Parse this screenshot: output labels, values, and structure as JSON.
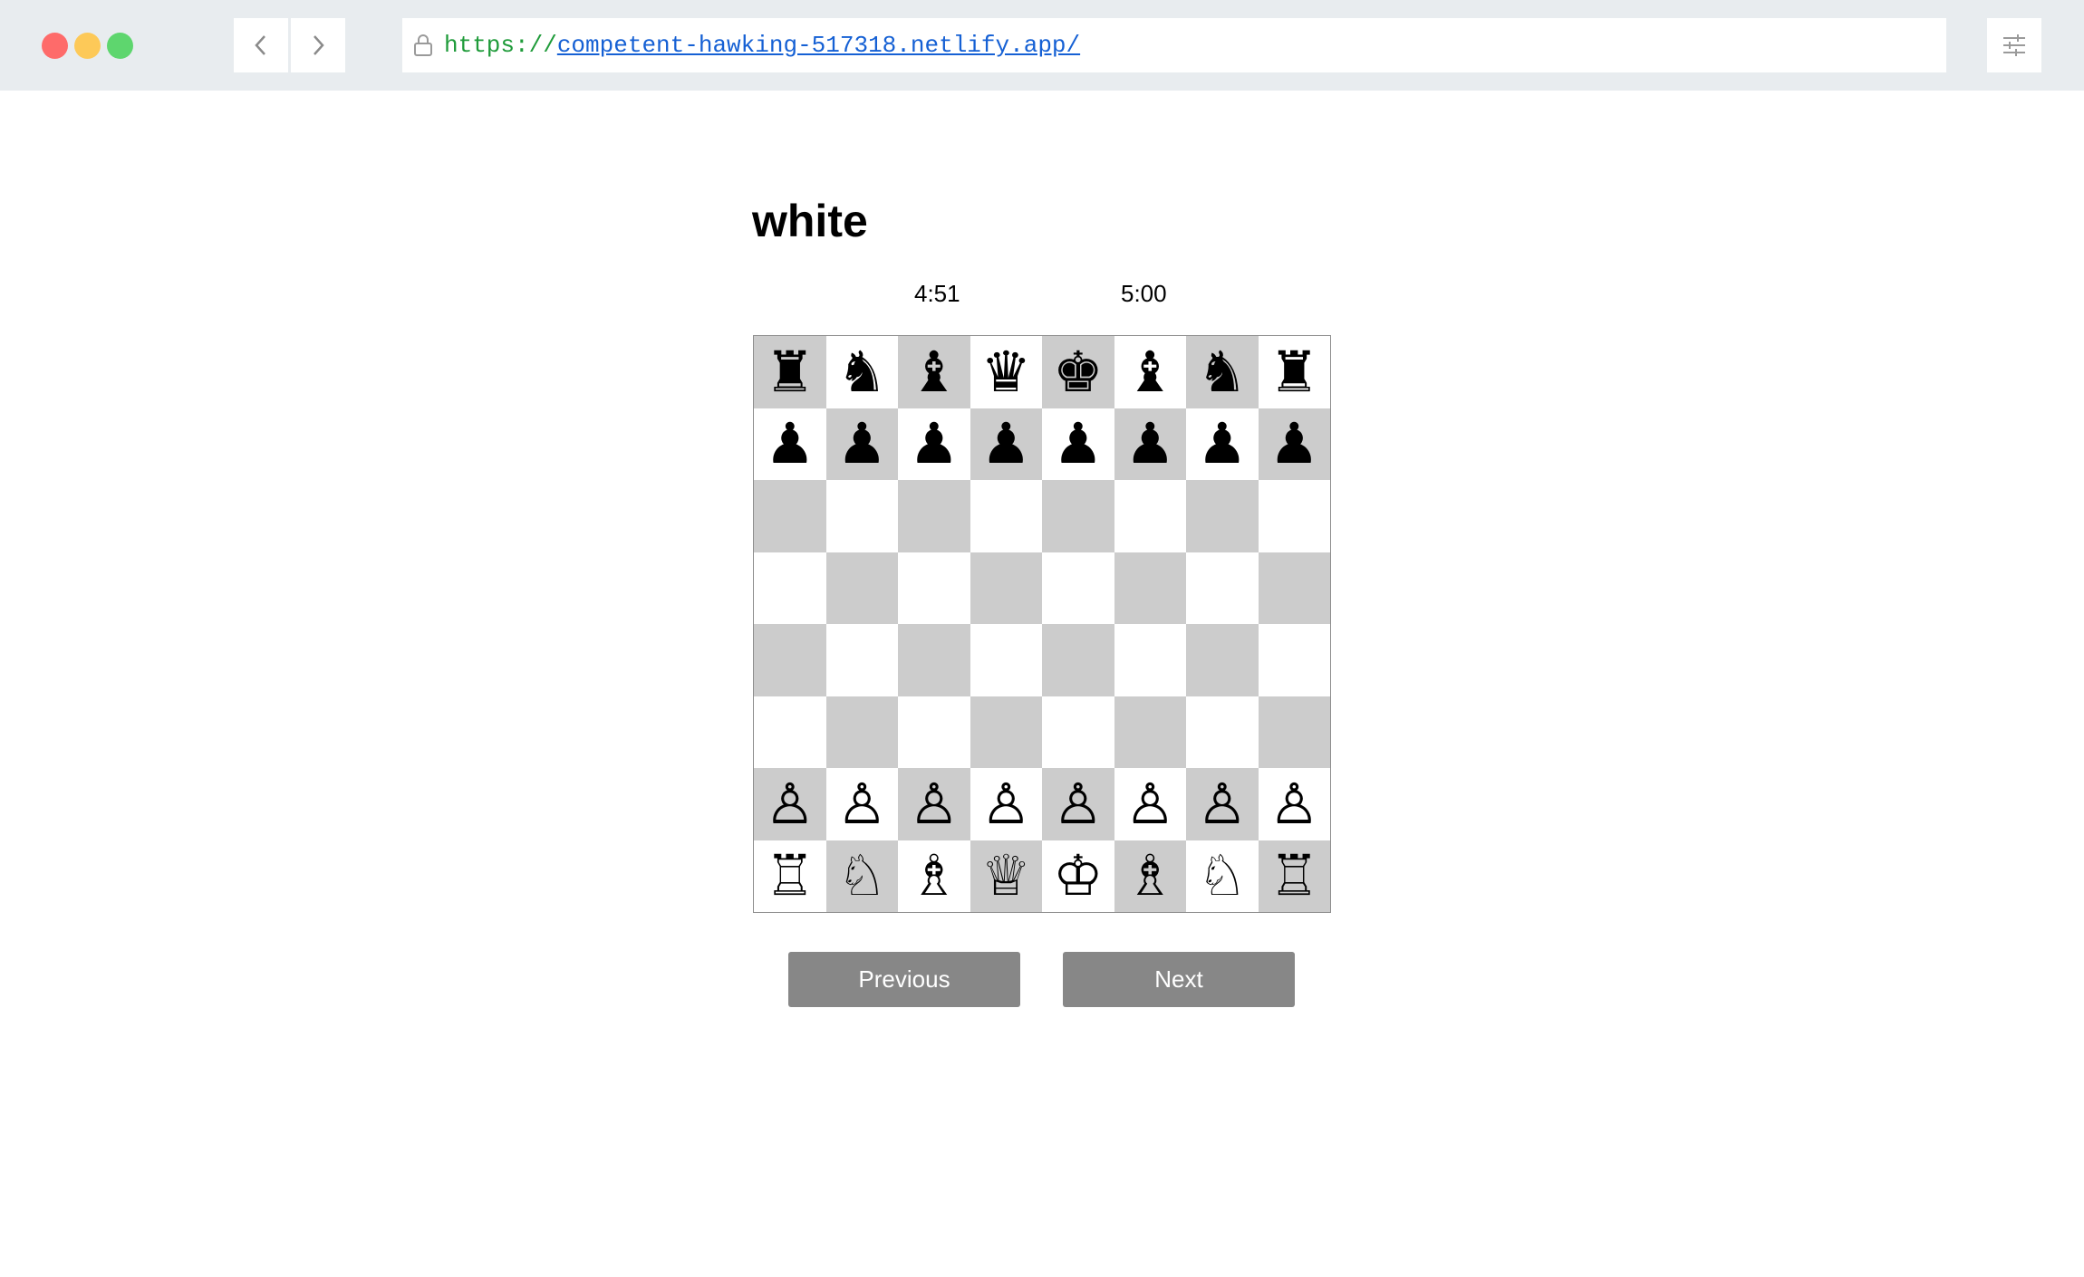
{
  "browser": {
    "url_scheme": "https://",
    "url_host": "competent-hawking-517318.netlify.app/"
  },
  "page": {
    "heading": "white",
    "timers": [
      "4:51",
      "5:00"
    ],
    "buttons": {
      "previous": "Previous",
      "next": "Next"
    }
  },
  "board": {
    "colors": {
      "light": "#ffffff",
      "dark": "#cccccc"
    },
    "top_left_square": "dark",
    "ranks": [
      [
        "black-rook",
        "black-knight",
        "black-bishop",
        "black-queen",
        "black-king",
        "black-bishop",
        "black-knight",
        "black-rook"
      ],
      [
        "black-pawn",
        "black-pawn",
        "black-pawn",
        "black-pawn",
        "black-pawn",
        "black-pawn",
        "black-pawn",
        "black-pawn"
      ],
      [
        "",
        "",
        "",
        "",
        "",
        "",
        "",
        ""
      ],
      [
        "",
        "",
        "",
        "",
        "",
        "",
        "",
        ""
      ],
      [
        "",
        "",
        "",
        "",
        "",
        "",
        "",
        ""
      ],
      [
        "",
        "",
        "",
        "",
        "",
        "",
        "",
        ""
      ],
      [
        "white-pawn",
        "white-pawn",
        "white-pawn",
        "white-pawn",
        "white-pawn",
        "white-pawn",
        "white-pawn",
        "white-pawn"
      ],
      [
        "white-rook",
        "white-knight",
        "white-bishop",
        "white-queen",
        "white-king",
        "white-bishop",
        "white-knight",
        "white-rook"
      ]
    ]
  }
}
